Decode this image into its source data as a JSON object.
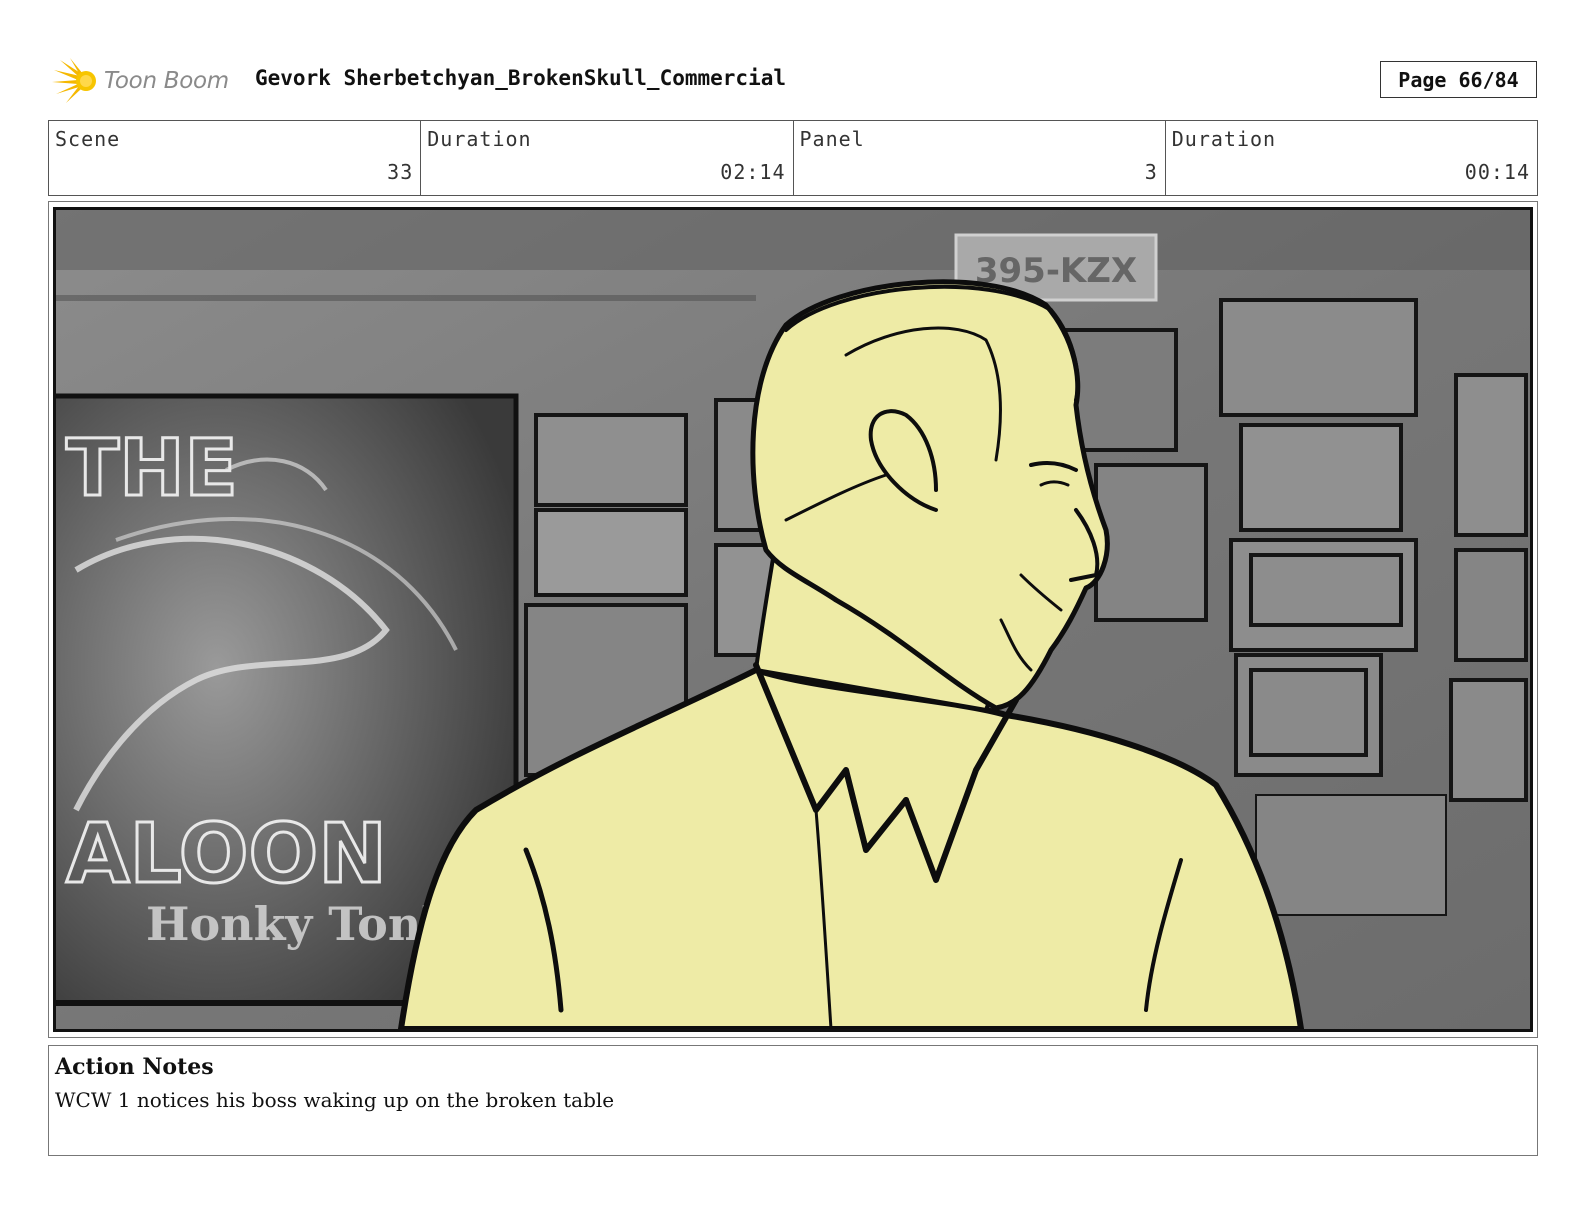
{
  "header": {
    "logo_text": "Toon Boom",
    "title": "Gevork Sherbetchyan_BrokenSkull_Commercial",
    "page_label": "Page 66/84"
  },
  "info": {
    "scene_label": "Scene",
    "scene_value": "33",
    "scene_duration_label": "Duration",
    "scene_duration_value": "02:14",
    "panel_label": "Panel",
    "panel_value": "3",
    "panel_duration_label": "Duration",
    "panel_duration_value": "00:14"
  },
  "panel_image": {
    "sign_text_top": "THE",
    "sign_text_bottom": "ALOON",
    "sign_text_tagline": "Honky Tonk",
    "plate_text": "395-KZX",
    "figure_fill": "#eeeba6",
    "background_gray": "#7a7a7a"
  },
  "notes": {
    "title": "Action Notes",
    "text": "WCW 1 notices his boss waking up on the broken table"
  }
}
